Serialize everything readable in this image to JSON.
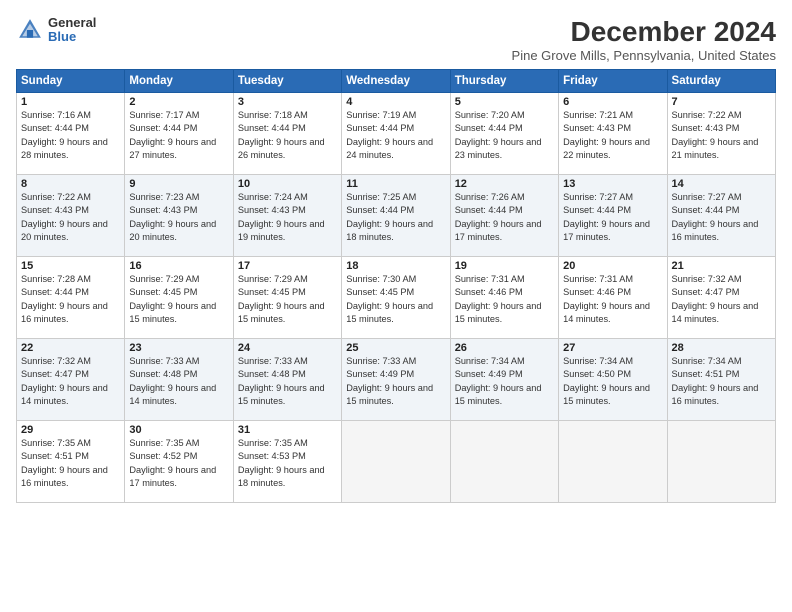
{
  "logo": {
    "general": "General",
    "blue": "Blue"
  },
  "title": "December 2024",
  "location": "Pine Grove Mills, Pennsylvania, United States",
  "days_header": [
    "Sunday",
    "Monday",
    "Tuesday",
    "Wednesday",
    "Thursday",
    "Friday",
    "Saturday"
  ],
  "weeks": [
    [
      {
        "day": "1",
        "sunrise": "7:16 AM",
        "sunset": "4:44 PM",
        "daylight": "9 hours and 28 minutes."
      },
      {
        "day": "2",
        "sunrise": "7:17 AM",
        "sunset": "4:44 PM",
        "daylight": "9 hours and 27 minutes."
      },
      {
        "day": "3",
        "sunrise": "7:18 AM",
        "sunset": "4:44 PM",
        "daylight": "9 hours and 26 minutes."
      },
      {
        "day": "4",
        "sunrise": "7:19 AM",
        "sunset": "4:44 PM",
        "daylight": "9 hours and 24 minutes."
      },
      {
        "day": "5",
        "sunrise": "7:20 AM",
        "sunset": "4:44 PM",
        "daylight": "9 hours and 23 minutes."
      },
      {
        "day": "6",
        "sunrise": "7:21 AM",
        "sunset": "4:43 PM",
        "daylight": "9 hours and 22 minutes."
      },
      {
        "day": "7",
        "sunrise": "7:22 AM",
        "sunset": "4:43 PM",
        "daylight": "9 hours and 21 minutes."
      }
    ],
    [
      {
        "day": "8",
        "sunrise": "7:22 AM",
        "sunset": "4:43 PM",
        "daylight": "9 hours and 20 minutes."
      },
      {
        "day": "9",
        "sunrise": "7:23 AM",
        "sunset": "4:43 PM",
        "daylight": "9 hours and 20 minutes."
      },
      {
        "day": "10",
        "sunrise": "7:24 AM",
        "sunset": "4:43 PM",
        "daylight": "9 hours and 19 minutes."
      },
      {
        "day": "11",
        "sunrise": "7:25 AM",
        "sunset": "4:44 PM",
        "daylight": "9 hours and 18 minutes."
      },
      {
        "day": "12",
        "sunrise": "7:26 AM",
        "sunset": "4:44 PM",
        "daylight": "9 hours and 17 minutes."
      },
      {
        "day": "13",
        "sunrise": "7:27 AM",
        "sunset": "4:44 PM",
        "daylight": "9 hours and 17 minutes."
      },
      {
        "day": "14",
        "sunrise": "7:27 AM",
        "sunset": "4:44 PM",
        "daylight": "9 hours and 16 minutes."
      }
    ],
    [
      {
        "day": "15",
        "sunrise": "7:28 AM",
        "sunset": "4:44 PM",
        "daylight": "9 hours and 16 minutes."
      },
      {
        "day": "16",
        "sunrise": "7:29 AM",
        "sunset": "4:45 PM",
        "daylight": "9 hours and 15 minutes."
      },
      {
        "day": "17",
        "sunrise": "7:29 AM",
        "sunset": "4:45 PM",
        "daylight": "9 hours and 15 minutes."
      },
      {
        "day": "18",
        "sunrise": "7:30 AM",
        "sunset": "4:45 PM",
        "daylight": "9 hours and 15 minutes."
      },
      {
        "day": "19",
        "sunrise": "7:31 AM",
        "sunset": "4:46 PM",
        "daylight": "9 hours and 15 minutes."
      },
      {
        "day": "20",
        "sunrise": "7:31 AM",
        "sunset": "4:46 PM",
        "daylight": "9 hours and 14 minutes."
      },
      {
        "day": "21",
        "sunrise": "7:32 AM",
        "sunset": "4:47 PM",
        "daylight": "9 hours and 14 minutes."
      }
    ],
    [
      {
        "day": "22",
        "sunrise": "7:32 AM",
        "sunset": "4:47 PM",
        "daylight": "9 hours and 14 minutes."
      },
      {
        "day": "23",
        "sunrise": "7:33 AM",
        "sunset": "4:48 PM",
        "daylight": "9 hours and 14 minutes."
      },
      {
        "day": "24",
        "sunrise": "7:33 AM",
        "sunset": "4:48 PM",
        "daylight": "9 hours and 15 minutes."
      },
      {
        "day": "25",
        "sunrise": "7:33 AM",
        "sunset": "4:49 PM",
        "daylight": "9 hours and 15 minutes."
      },
      {
        "day": "26",
        "sunrise": "7:34 AM",
        "sunset": "4:49 PM",
        "daylight": "9 hours and 15 minutes."
      },
      {
        "day": "27",
        "sunrise": "7:34 AM",
        "sunset": "4:50 PM",
        "daylight": "9 hours and 15 minutes."
      },
      {
        "day": "28",
        "sunrise": "7:34 AM",
        "sunset": "4:51 PM",
        "daylight": "9 hours and 16 minutes."
      }
    ],
    [
      {
        "day": "29",
        "sunrise": "7:35 AM",
        "sunset": "4:51 PM",
        "daylight": "9 hours and 16 minutes."
      },
      {
        "day": "30",
        "sunrise": "7:35 AM",
        "sunset": "4:52 PM",
        "daylight": "9 hours and 17 minutes."
      },
      {
        "day": "31",
        "sunrise": "7:35 AM",
        "sunset": "4:53 PM",
        "daylight": "9 hours and 18 minutes."
      },
      null,
      null,
      null,
      null
    ]
  ]
}
